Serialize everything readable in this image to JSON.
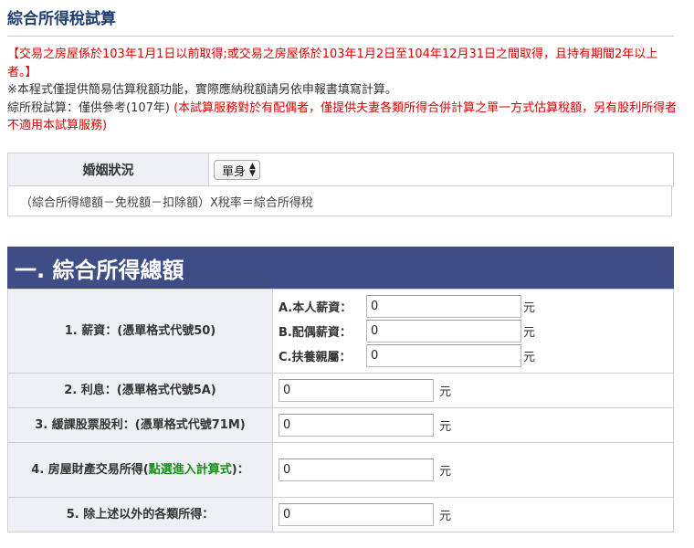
{
  "page_title": "綜合所得稅試算",
  "notes": {
    "red_notice": "【交易之房屋係於103年1月1日以前取得;或交易之房屋係於103年1月2日至104年12月31日之間取得，且持有期間2年以上者。】",
    "disclaimer": "※本程式僅提供簡易估算稅額功能，實際應納稅額請另依申報書填寫計算。",
    "trial_label": "綜所稅試算：僅供參考(107年)",
    "trial_red": "(本試算服務對於有配偶者，僅提供夫妻各類所得合併計算之單一方式估算稅額，另有股利所得者不適用本試算服務)"
  },
  "marital": {
    "label": "婚姻狀況",
    "selected": "單身"
  },
  "formula": "（綜合所得總額－免稅額－扣除額）X稅率＝綜合所得稅",
  "section_title": "一. 綜合所得總額",
  "unit": "元",
  "rows": {
    "salary": {
      "label": "1. 薪資：(憑單格式代號50)",
      "subs": [
        {
          "label": "A.本人薪資：",
          "value": "0"
        },
        {
          "label": "B.配偶薪資：",
          "value": "0"
        },
        {
          "label": "C.扶養親屬：",
          "value": "0"
        }
      ]
    },
    "interest": {
      "label": "2. 利息：(憑單格式代號5A)",
      "value": "0"
    },
    "deferred_dividend": {
      "label": "3. 緩課股票股利：(憑單格式代號71M)",
      "value": "0"
    },
    "house_trade": {
      "label_prefix": "4. 房屋財產交易所得(",
      "link": "點選進入計算式",
      "label_suffix": ")：",
      "value": "0"
    },
    "other": {
      "label": "5. 除上述以外的各類所得：",
      "value": "0"
    }
  }
}
